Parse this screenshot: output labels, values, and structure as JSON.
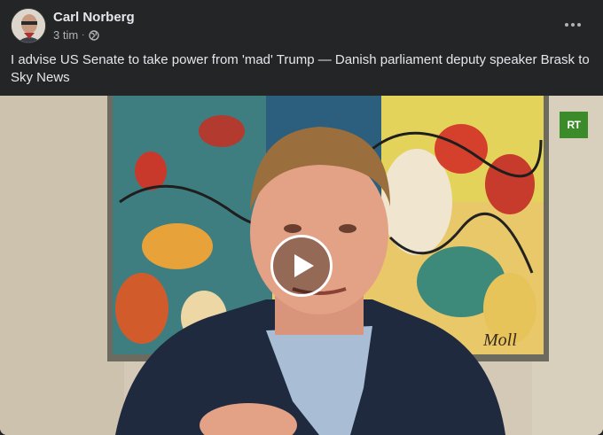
{
  "post": {
    "author": "Carl Norberg",
    "timestamp": "3 tim",
    "separator": "·",
    "audience_icon": "globe-icon",
    "more_icon": "more-options-icon",
    "caption": "I advise US Senate to take power from 'mad' Trump — Danish parliament deputy speaker Brask to Sky News"
  },
  "video": {
    "channel_badge": "RT",
    "painting_signature": "Moll",
    "play_icon": "play-icon",
    "badge_color": "#3c8b2a"
  }
}
